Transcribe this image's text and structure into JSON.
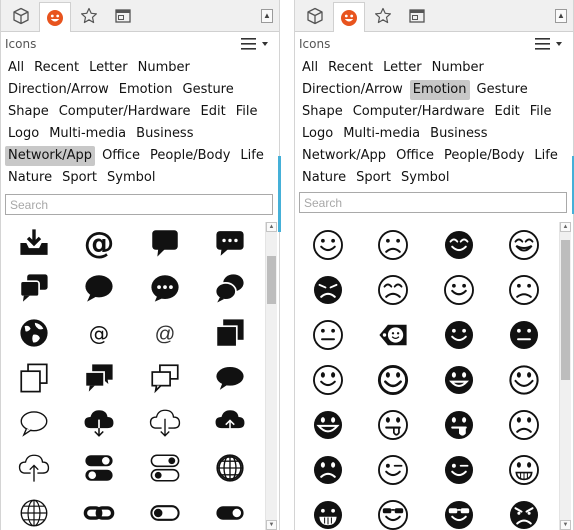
{
  "left": {
    "title": "Icons",
    "categories": [
      "All",
      "Recent",
      "Letter",
      "Number",
      "Direction/Arrow",
      "Emotion",
      "Gesture",
      "Shape",
      "Computer/Hardware",
      "Edit",
      "File",
      "Logo",
      "Multi-media",
      "Business",
      "Network/App",
      "Office",
      "People/Body",
      "Life",
      "Nature",
      "Sport",
      "Symbol"
    ],
    "selected_category": "Network/App",
    "search_placeholder": "Search",
    "icons": [
      "inbox-download",
      "at-sign-bold",
      "speech-bubble-square",
      "chat-dots-square",
      "chat-bubbles-stack",
      "speech-bubble-oval",
      "chat-dots-round",
      "chat-bubbles-pair",
      "globe-at",
      "at-sign-outline",
      "at-sign-light",
      "windows-stacked",
      "windows-outline",
      "chat-squares-filled",
      "chat-squares-outline",
      "speech-oval-filled",
      "speech-oval-outline",
      "cloud-download-filled",
      "cloud-download-outline",
      "cloud-upload-filled",
      "cloud-upload-outline",
      "toggle-pair-filled",
      "toggle-pair-outline",
      "globe-grid",
      "globe-wire",
      "link",
      "toggle-off",
      "toggle-on"
    ]
  },
  "right": {
    "title": "Icons",
    "categories": [
      "All",
      "Recent",
      "Letter",
      "Number",
      "Direction/Arrow",
      "Emotion",
      "Gesture",
      "Shape",
      "Computer/Hardware",
      "Edit",
      "File",
      "Logo",
      "Multi-media",
      "Business",
      "Network/App",
      "Office",
      "People/Body",
      "Life",
      "Nature",
      "Sport",
      "Symbol"
    ],
    "selected_category": "Emotion",
    "search_placeholder": "Search",
    "icons": [
      "smile-outline",
      "frown-outline",
      "smile-filled",
      "grin-outline",
      "sad-filled",
      "sad-outline",
      "smile-outline-2",
      "frown-outline-2",
      "neutral-outline",
      "face-tag",
      "smile-filled-2",
      "neutral-filled",
      "smile-outline-3",
      "smile-bold",
      "grin-filled",
      "smile-bold-outline",
      "grin-wide-filled",
      "tongue-out",
      "tongue-filled",
      "frown-outline-3",
      "frown-filled",
      "wink-outline",
      "wink-filled",
      "grin-teeth-outline",
      "teeth-filled",
      "sunglasses-outline",
      "sunglasses-filled",
      "angry-filled"
    ]
  },
  "colors": {
    "accent": "#45b0d8",
    "selected_bg": "#c8c8c8",
    "tabbar_bg": "#f0f0f0",
    "smiley_orange": "#e8541e"
  }
}
